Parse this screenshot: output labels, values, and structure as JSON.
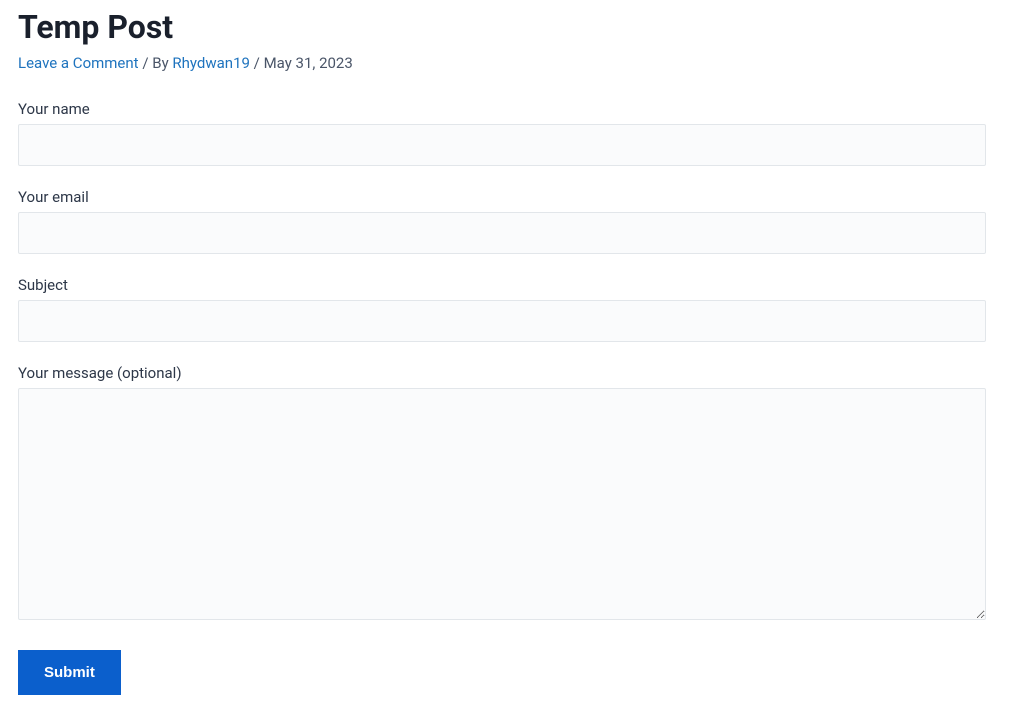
{
  "post": {
    "title": "Temp Post",
    "meta": {
      "leave_comment": "Leave a Comment",
      "sep1": " / By ",
      "author": "Rhydwan19",
      "sep2": " / ",
      "date": "May 31, 2023"
    }
  },
  "form": {
    "name_label": "Your name",
    "email_label": "Your email",
    "subject_label": "Subject",
    "message_label": "Your message (optional)",
    "submit_label": "Submit"
  }
}
